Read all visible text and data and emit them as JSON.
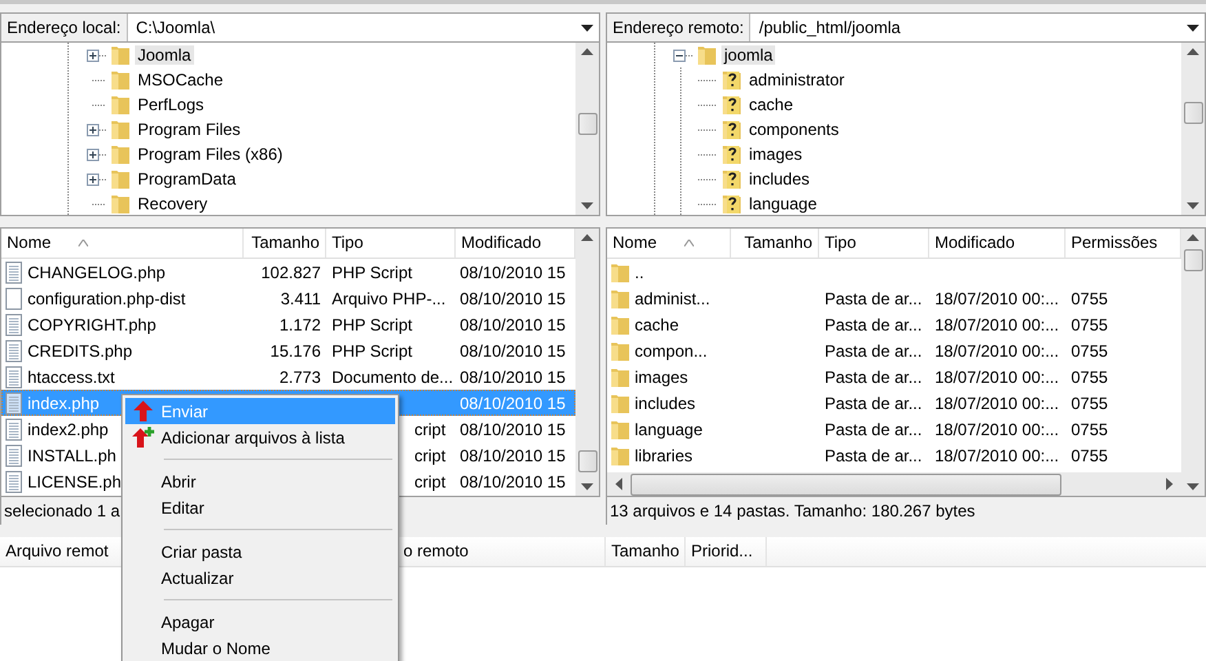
{
  "local": {
    "address_label": "Endereço local:",
    "address": "C:\\Joomla\\",
    "tree": [
      {
        "name": "Joomla",
        "expandable": true,
        "selected": true
      },
      {
        "name": "MSOCache",
        "expandable": false,
        "selected": false
      },
      {
        "name": "PerfLogs",
        "expandable": false,
        "selected": false
      },
      {
        "name": "Program Files",
        "expandable": true,
        "selected": false
      },
      {
        "name": "Program Files (x86)",
        "expandable": true,
        "selected": false
      },
      {
        "name": "ProgramData",
        "expandable": true,
        "selected": false
      },
      {
        "name": "Recovery",
        "expandable": false,
        "selected": false
      }
    ],
    "columns": [
      "Nome",
      "Tamanho",
      "Tipo",
      "Modificado"
    ],
    "rows": [
      {
        "name": "CHANGELOG.php",
        "size": "102.827",
        "type": "PHP Script",
        "modified": "08/10/2010 15",
        "kind": "script",
        "selected": false,
        "covered": false
      },
      {
        "name": "configuration.php-dist",
        "size": "3.411",
        "type": "Arquivo PHP-...",
        "modified": "08/10/2010 15",
        "kind": "plain",
        "selected": false,
        "covered": false
      },
      {
        "name": "COPYRIGHT.php",
        "size": "1.172",
        "type": "PHP Script",
        "modified": "08/10/2010 15",
        "kind": "script",
        "selected": false,
        "covered": false
      },
      {
        "name": "CREDITS.php",
        "size": "15.176",
        "type": "PHP Script",
        "modified": "08/10/2010 15",
        "kind": "script",
        "selected": false,
        "covered": false
      },
      {
        "name": "htaccess.txt",
        "size": "2.773",
        "type": "Documento de...",
        "modified": "08/10/2010 15",
        "kind": "script",
        "selected": false,
        "covered": false
      },
      {
        "name": "index.php",
        "modified": "08/10/2010 15",
        "kind": "script",
        "selected": true
      },
      {
        "name": "index2.php",
        "type": "cript",
        "modified": "08/10/2010 15",
        "kind": "script",
        "selected": false,
        "covered": true
      },
      {
        "name": "INSTALL.ph",
        "type": "cript",
        "modified": "08/10/2010 15",
        "kind": "script",
        "selected": false,
        "covered": true
      },
      {
        "name": "LICENSE.ph",
        "type": "cript",
        "modified": "08/10/2010 15",
        "kind": "script",
        "selected": false,
        "covered": true
      }
    ],
    "status": "selecionado 1 a"
  },
  "remote": {
    "address_label": "Endereço remoto:",
    "address": "/public_html/joomla",
    "tree": [
      {
        "name": "joomla",
        "expanded": true,
        "selected": true,
        "children": [
          {
            "name": "administrator"
          },
          {
            "name": "cache"
          },
          {
            "name": "components"
          },
          {
            "name": "images"
          },
          {
            "name": "includes"
          },
          {
            "name": "language"
          }
        ]
      }
    ],
    "columns": [
      "Nome",
      "Tamanho",
      "Tipo",
      "Modificado",
      "Permissões"
    ],
    "rows": [
      {
        "name": ".."
      },
      {
        "name": "administ...",
        "type": "Pasta de ar...",
        "modified": "18/07/2010 00:...",
        "permissions": "0755"
      },
      {
        "name": "cache",
        "type": "Pasta de ar...",
        "modified": "18/07/2010 00:...",
        "permissions": "0755"
      },
      {
        "name": "compon...",
        "type": "Pasta de ar...",
        "modified": "18/07/2010 00:...",
        "permissions": "0755"
      },
      {
        "name": "images",
        "type": "Pasta de ar...",
        "modified": "18/07/2010 00:...",
        "permissions": "0755"
      },
      {
        "name": "includes",
        "type": "Pasta de ar...",
        "modified": "18/07/2010 00:...",
        "permissions": "0755"
      },
      {
        "name": "language",
        "type": "Pasta de ar...",
        "modified": "18/07/2010 00:...",
        "permissions": "0755"
      },
      {
        "name": "libraries",
        "type": "Pasta de ar...",
        "modified": "18/07/2010 00:...",
        "permissions": "0755"
      }
    ],
    "status": "13 arquivos e 14 pastas. Tamanho: 180.267 bytes"
  },
  "queue": {
    "columns": [
      "Arquivo remot",
      "o remoto",
      "Tamanho",
      "Priorid..."
    ]
  },
  "context_menu": [
    {
      "kind": "upload_item",
      "label": "Enviar",
      "selected": true
    },
    {
      "kind": "add_item",
      "label": "Adicionar arquivos à lista",
      "selected": false
    },
    {
      "kind": "separator"
    },
    {
      "kind": "item",
      "label": "Abrir",
      "selected": false
    },
    {
      "kind": "item",
      "label": "Editar",
      "selected": false
    },
    {
      "kind": "separator"
    },
    {
      "kind": "item",
      "label": "Criar pasta",
      "selected": false
    },
    {
      "kind": "item",
      "label": "Actualizar",
      "selected": false
    },
    {
      "kind": "separator"
    },
    {
      "kind": "item",
      "label": "Apagar",
      "selected": false
    },
    {
      "kind": "item",
      "label": "Mudar o Nome",
      "selected": false
    }
  ]
}
